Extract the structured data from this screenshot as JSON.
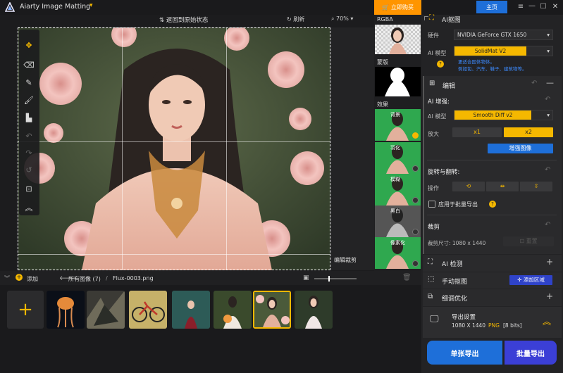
{
  "app": {
    "title": "Aiarty Image Matting",
    "buy_label": "立即购买",
    "home_label": "主页"
  },
  "canvas": {
    "undo_label": "返回到原始状态",
    "refresh_label": "刷新",
    "zoom": "70%",
    "edit_crop_label": "编辑裁剪"
  },
  "thumbs": {
    "rgba_label": "RGBA",
    "mask_label": "蒙版",
    "effects_label": "效果",
    "effects": [
      "背景",
      "羽化",
      "模糊",
      "黑白",
      "像素化"
    ]
  },
  "bottom": {
    "add_label": "添加",
    "breadcrumb_all": "所有图像 (7)",
    "breadcrumb_sep": "/",
    "file_name": "Flux-0003.png"
  },
  "panel": {
    "ai_matting": {
      "title": "AI抠图",
      "hardware_label": "硬件",
      "hardware_value": "NVIDIA GeForce GTX 1650",
      "model_label": "AI 模型",
      "model_value": "SolidMat  V2",
      "model_hint_line1": "更适合固体物体。",
      "model_hint_line2": "例如包、汽车、鞋子、建筑物等。"
    },
    "edit": {
      "title": "编辑",
      "enhance_label": "AI 增强:",
      "model_label": "AI 模型",
      "model_value": "Smooth Diff v2",
      "scale_label": "放大",
      "x1": "x1",
      "x2": "x2",
      "enhance_button": "增强图像",
      "rotate_label": "旋转与翻转:",
      "op_label": "操作",
      "batch_label": "应用于批量导出",
      "crop_label": "裁剪",
      "crop_size": "裁剪尺寸: 1080 x 1440",
      "reset_label": "重置"
    },
    "ai_detect": {
      "title": "AI 检测"
    },
    "manual": {
      "title": "手动抠图",
      "add_area": "添加区域"
    },
    "refine": {
      "title": "细调优化"
    },
    "export": {
      "title": "导出设置",
      "size": "1080 X 1440",
      "format": "PNG",
      "bits": "[8 bits]",
      "single": "单张导出",
      "batch": "批量导出"
    }
  },
  "colors": {
    "accent": "#f5b800",
    "blue": "#1e6fd9",
    "green": "#2fa84f",
    "orange": "#ff9500"
  }
}
